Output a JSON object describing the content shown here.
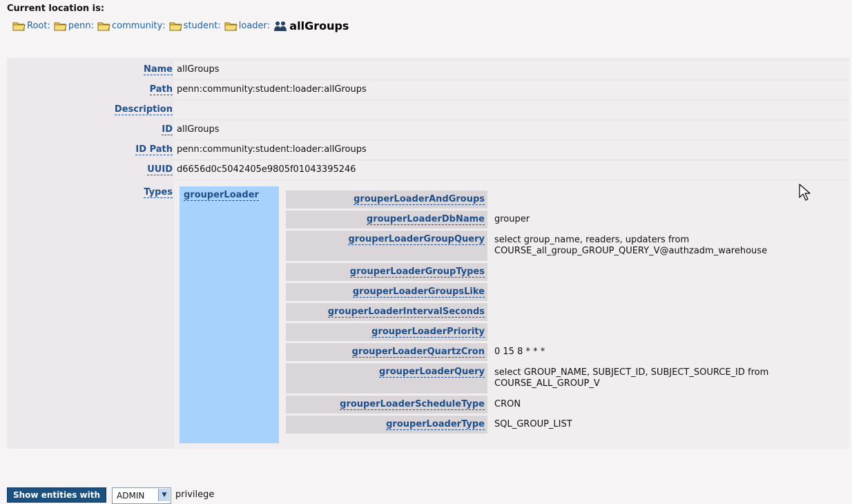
{
  "location": {
    "heading": "Current location is:",
    "crumbs": [
      {
        "label": "Root",
        "sep": ":"
      },
      {
        "label": "penn",
        "sep": ":"
      },
      {
        "label": "community",
        "sep": ":"
      },
      {
        "label": "student",
        "sep": ":"
      },
      {
        "label": "loader",
        "sep": ":"
      }
    ],
    "current": "allGroups"
  },
  "fields": [
    {
      "label": "Name",
      "value": "allGroups"
    },
    {
      "label": "Path",
      "value": "penn:community:student:loader:allGroups"
    },
    {
      "label": "Description",
      "value": ""
    },
    {
      "label": "ID",
      "value": "allGroups"
    },
    {
      "label": "ID Path",
      "value": "penn:community:student:loader:allGroups"
    },
    {
      "label": "UUID",
      "value": "d6656d0c5042405e9805f01043395246"
    }
  ],
  "types": {
    "label": "Types",
    "type_name": "grouperLoader",
    "attributes": [
      {
        "label": "grouperLoaderAndGroups",
        "value": ""
      },
      {
        "label": "grouperLoaderDbName",
        "value": "grouper"
      },
      {
        "label": "grouperLoaderGroupQuery",
        "value": "select group_name, readers, updaters from COURSE_all_group_GROUP_QUERY_V@authzadm_warehouse"
      },
      {
        "label": "grouperLoaderGroupTypes",
        "value": ""
      },
      {
        "label": "grouperLoaderGroupsLike",
        "value": ""
      },
      {
        "label": "grouperLoaderIntervalSeconds",
        "value": ""
      },
      {
        "label": "grouperLoaderPriority",
        "value": ""
      },
      {
        "label": "grouperLoaderQuartzCron",
        "value": "0 15 8 * * *"
      },
      {
        "label": "grouperLoaderQuery",
        "value": "select GROUP_NAME, SUBJECT_ID, SUBJECT_SOURCE_ID from COURSE_ALL_GROUP_V"
      },
      {
        "label": "grouperLoaderScheduleType",
        "value": "CRON"
      },
      {
        "label": "grouperLoaderType",
        "value": "SQL_GROUP_LIST"
      }
    ]
  },
  "bottom": {
    "button_label": "Show entities with",
    "select_value": "ADMIN",
    "suffix": "privilege"
  }
}
